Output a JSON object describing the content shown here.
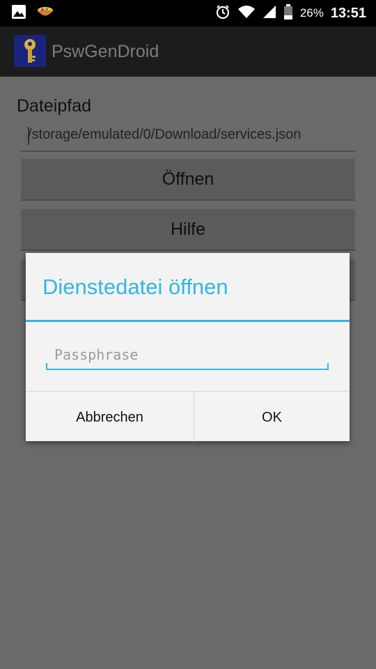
{
  "status_bar": {
    "icons_left": [
      "image-icon",
      "food-bowl-icon"
    ],
    "icons_right": [
      "alarm-icon",
      "wifi-icon",
      "cell-signal-icon",
      "battery-icon"
    ],
    "battery_percent": "26%",
    "time": "13:51"
  },
  "action_bar": {
    "title": "PswGenDroid",
    "icon": "key-icon"
  },
  "main": {
    "path_label": "Dateipfad",
    "path_value": "/storage/emulated/0/Download/services.json",
    "buttons": [
      "Öffnen",
      "Hilfe",
      ""
    ]
  },
  "dialog": {
    "title": "Dienstedatei öffnen",
    "passphrase_placeholder": "Passphrase",
    "cancel_label": "Abbrechen",
    "ok_label": "OK"
  },
  "colors": {
    "accent": "#33b5e5",
    "dim_background": "#6a6a6a",
    "dialog_background": "#f3f3f3"
  }
}
